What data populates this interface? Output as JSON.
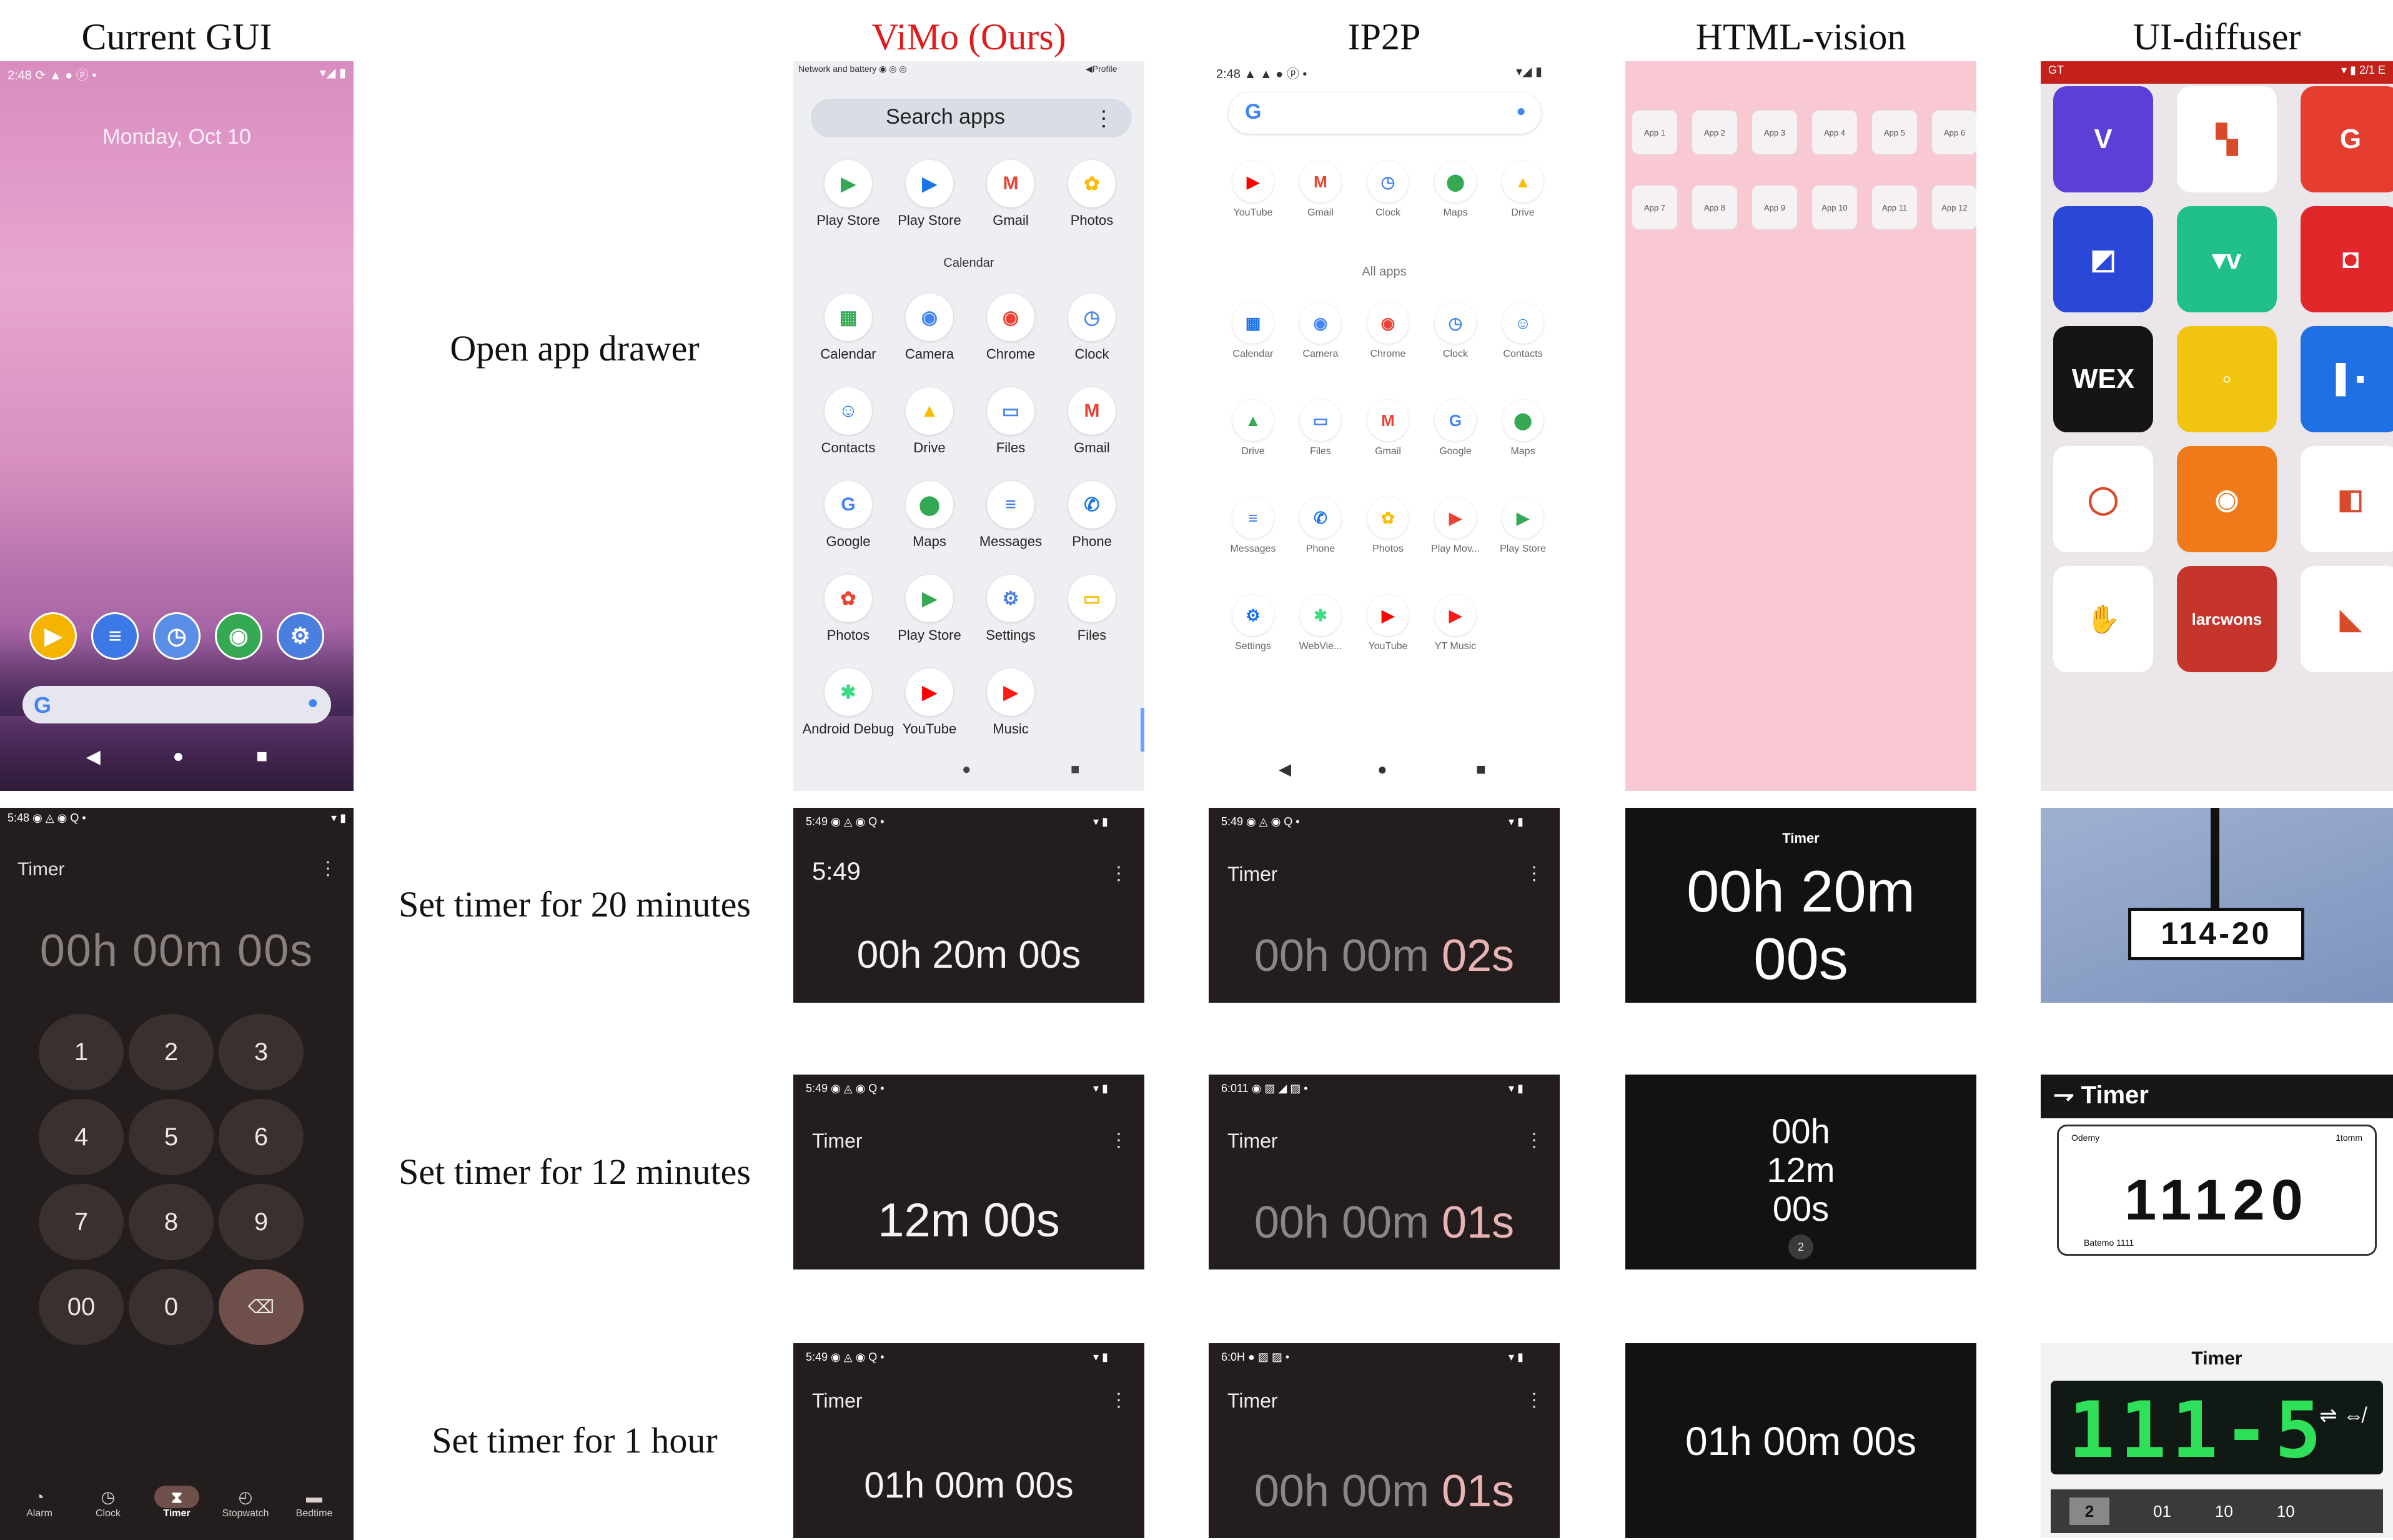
{
  "headers": {
    "current": "Current GUI",
    "vimo": "ViMo (Ours)",
    "ip2p": "IP2P",
    "html_vision": "HTML-vision",
    "ui_diffuser": "UI-diffuser"
  },
  "instructions": [
    "Open app drawer",
    "Set timer for 20 minutes",
    "Set timer for 12 minutes",
    "Set timer for  1 hour"
  ],
  "colors": {
    "vimo_header": "#e01b1b",
    "timer_dark": "#231d1d",
    "hv_pink": "#f8c8d3",
    "key_highlight": "#6e4f49"
  },
  "current_home": {
    "status_time": "2:48",
    "status_icons": "⟳ ▲ ● ⓟ •",
    "status_right": "▾◢ ▮",
    "date": "Monday, Oct 10",
    "dock": [
      {
        "icon": "play-store-icon",
        "glyph": "▶",
        "color": "#f4b400"
      },
      {
        "icon": "messages-icon",
        "glyph": "≡",
        "color": "#3c78e6"
      },
      {
        "icon": "clock-icon",
        "glyph": "◷",
        "color": "#5b8ee6"
      },
      {
        "icon": "chrome-icon",
        "glyph": "◉",
        "color": "#34a853"
      },
      {
        "icon": "settings-icon",
        "glyph": "⚙",
        "color": "#4a7fe0"
      }
    ],
    "nav": [
      "◀",
      "●",
      "■"
    ]
  },
  "current_timer": {
    "status_time": "5:48",
    "status_icons": "◉ ◬ ◉ Q •",
    "status_right": "▾ ▮",
    "title": "Timer",
    "menu": "⋮",
    "display": "00h 00m 00s",
    "keys": [
      "1",
      "2",
      "3",
      "4",
      "5",
      "6",
      "7",
      "8",
      "9",
      "00",
      "0",
      "⌫"
    ],
    "nav": [
      {
        "icon": "◔",
        "label": "Alarm"
      },
      {
        "icon": "◷",
        "label": "Clock"
      },
      {
        "icon": "⧗",
        "label": "Timer",
        "selected": true
      },
      {
        "icon": "◴",
        "label": "Stopwatch"
      },
      {
        "icon": "▬",
        "label": "Bedtime"
      }
    ]
  },
  "vimo_drawer": {
    "status_left": "Network and battery  ◉ ◎ ◎",
    "status_right": "◀Profile",
    "search": "Search apps",
    "menu": "⋮",
    "row0": [
      {
        "label": "Play Store",
        "glyph": "▶",
        "color": "#34a853"
      },
      {
        "label": "Play Store",
        "glyph": "▶",
        "color": "#1a73e8"
      },
      {
        "label": "Gmail",
        "glyph": "M",
        "color": "#ea4335"
      },
      {
        "label": "Photos",
        "glyph": "✿",
        "color": "#fbbc05"
      }
    ],
    "section": "Calendar",
    "apps": [
      {
        "label": "Calendar",
        "glyph": "▦",
        "color": "#34a853"
      },
      {
        "label": "Camera",
        "glyph": "◉",
        "color": "#4285f4"
      },
      {
        "label": "Chrome",
        "glyph": "◉",
        "color": "#ea4335"
      },
      {
        "label": "Clock",
        "glyph": "◷",
        "color": "#4a88e8"
      },
      {
        "label": "Contacts",
        "glyph": "☺",
        "color": "#1a73e8"
      },
      {
        "label": "Drive",
        "glyph": "▲",
        "color": "#fbbc05"
      },
      {
        "label": "Files",
        "glyph": "▭",
        "color": "#4285f4"
      },
      {
        "label": "Gmail",
        "glyph": "M",
        "color": "#ea4335"
      },
      {
        "label": "Google",
        "glyph": "G",
        "color": "#4285f4"
      },
      {
        "label": "Maps",
        "glyph": "⬤",
        "color": "#34a853"
      },
      {
        "label": "Messages",
        "glyph": "≡",
        "color": "#3c78e6"
      },
      {
        "label": "Phone",
        "glyph": "✆",
        "color": "#1a73e8"
      },
      {
        "label": "Photos",
        "glyph": "✿",
        "color": "#ea4335"
      },
      {
        "label": "Play Store",
        "glyph": "▶",
        "color": "#34a853"
      },
      {
        "label": "Settings",
        "glyph": "⚙",
        "color": "#4a7fe0"
      },
      {
        "label": "Files",
        "glyph": "▭",
        "color": "#fbbc05"
      },
      {
        "label": "Android Debug",
        "glyph": "✱",
        "color": "#3ddc84"
      },
      {
        "label": "YouTube",
        "glyph": "▶",
        "color": "#ff0000"
      },
      {
        "label": "Music",
        "glyph": "▶",
        "color": "#ff1a1a"
      },
      {
        "label": "",
        "glyph": "",
        "color": "#eeeff3"
      }
    ],
    "nav": [
      "●",
      "■"
    ]
  },
  "ip2p_drawer": {
    "status_left": "2:48  ▲ ▲ ● ⓟ •",
    "status_right": "▾◢ ▮",
    "row0": [
      {
        "label": "YouTube",
        "glyph": "▶",
        "color": "#ff0000"
      },
      {
        "label": "Gmail",
        "glyph": "M",
        "color": "#ea4335"
      },
      {
        "label": "Clock",
        "glyph": "◷",
        "color": "#4a88e8"
      },
      {
        "label": "Maps",
        "glyph": "⬤",
        "color": "#34a853"
      },
      {
        "label": "Drive",
        "glyph": "▲",
        "color": "#fbbc05"
      }
    ],
    "section": "All apps",
    "apps": [
      {
        "label": "Calendar",
        "glyph": "▦",
        "color": "#1a73e8"
      },
      {
        "label": "Camera",
        "glyph": "◉",
        "color": "#4285f4"
      },
      {
        "label": "Chrome",
        "glyph": "◉",
        "color": "#ea4335"
      },
      {
        "label": "Clock",
        "glyph": "◷",
        "color": "#4a88e8"
      },
      {
        "label": "Contacts",
        "glyph": "☺",
        "color": "#1a73e8"
      },
      {
        "label": "Drive",
        "glyph": "▲",
        "color": "#34a853"
      },
      {
        "label": "Files",
        "glyph": "▭",
        "color": "#4285f4"
      },
      {
        "label": "Gmail",
        "glyph": "M",
        "color": "#ea4335"
      },
      {
        "label": "Google",
        "glyph": "G",
        "color": "#4285f4"
      },
      {
        "label": "Maps",
        "glyph": "⬤",
        "color": "#34a853"
      },
      {
        "label": "Messages",
        "glyph": "≡",
        "color": "#3c78e6"
      },
      {
        "label": "Phone",
        "glyph": "✆",
        "color": "#1a73e8"
      },
      {
        "label": "Photos",
        "glyph": "✿",
        "color": "#fbbc05"
      },
      {
        "label": "Play Mov...",
        "glyph": "▶",
        "color": "#ea4335"
      },
      {
        "label": "Play Store",
        "glyph": "▶",
        "color": "#34a853"
      },
      {
        "label": "Settings",
        "glyph": "⚙",
        "color": "#1a73e8"
      },
      {
        "label": "WebVie...",
        "glyph": "✱",
        "color": "#3ddc84"
      },
      {
        "label": "YouTube",
        "glyph": "▶",
        "color": "#ff0000"
      },
      {
        "label": "YT Music",
        "glyph": "▶",
        "color": "#ff1a1a"
      }
    ],
    "nav": [
      "◀",
      "●",
      "■"
    ]
  },
  "hv_drawer": {
    "apps": [
      "App 1",
      "App 2",
      "App 3",
      "App 4",
      "App 5",
      "App 6",
      "App 7",
      "App 8",
      "App 9",
      "App 10",
      "App 11",
      "App 12"
    ]
  },
  "ud_drawer": {
    "status_left": "GT",
    "status_right": "▾ ▮ 2/1 E",
    "tiles": [
      {
        "glyph": "V",
        "color": "#5b3fd6"
      },
      {
        "glyph": "▚",
        "color": "#ffffff"
      },
      {
        "glyph": "G",
        "color": "#e53d2f"
      },
      {
        "glyph": "◩",
        "color": "#2b47d8"
      },
      {
        "glyph": "▾v",
        "color": "#21c08b"
      },
      {
        "glyph": "◘",
        "color": "#e2272b"
      },
      {
        "glyph": "WEX",
        "color": "#151515"
      },
      {
        "glyph": "◦",
        "color": "#f1c40f"
      },
      {
        "glyph": "▌▪",
        "color": "#1f6fe5"
      },
      {
        "glyph": "◯",
        "color": "#ffffff"
      },
      {
        "glyph": "◉",
        "color": "#f07a1a"
      },
      {
        "glyph": "◧",
        "color": "#ffffff"
      },
      {
        "glyph": "✋",
        "color": "#ffffff"
      },
      {
        "glyph": "larcwons",
        "color": "#c6352b"
      },
      {
        "glyph": "◣",
        "color": "#ffffff"
      }
    ]
  },
  "results": {
    "vimo": [
      {
        "status": "5:49  ◉ ◬ ◉ Q •",
        "status_right": "▾ ▮",
        "title": "5:49",
        "value": "00h 20m 00s",
        "menu": "⋮"
      },
      {
        "status": "5:49  ◉ ◬ ◉ Q •",
        "status_right": "▾ ▮",
        "title": "Timer",
        "value": "12m 00s",
        "menu": "⋮"
      },
      {
        "status": "5:49  ◉ ◬ ◉ Q •",
        "status_right": "▾ ▮",
        "title": "Timer",
        "value": "01h 00m 00s",
        "menu": "⋮"
      }
    ],
    "ip2p": [
      {
        "status": "5:49  ◉ ◬ ◉ Q •",
        "status_right": "▾ ▮",
        "title": "Timer",
        "value_main": "00h 00m ",
        "value_accent": "02s",
        "menu": "⋮"
      },
      {
        "status": "6:011  ◉ ▨ ◢ ▨ •",
        "status_right": "▾ ▮",
        "title": "Timer",
        "value_main": "00h 00m ",
        "value_accent": "01s",
        "menu": "⋮"
      },
      {
        "status": "6:0H  ● ▨ ▨ •",
        "status_right": "▾ ▮",
        "title": "Timer",
        "value_main": "00h 00m ",
        "value_accent": "01s",
        "menu": "⋮"
      }
    ],
    "hv": [
      {
        "small": "Timer",
        "big1": "00h 20m",
        "big2": "00s"
      },
      {
        "l1": "00h",
        "l2": "12m",
        "l3": "00s",
        "dot": "2"
      },
      {
        "value": "01h 00m 00s"
      }
    ],
    "ud": [
      {
        "text": "114-20"
      },
      {
        "title": "Timer",
        "small_l": "Odemy",
        "small_r": "1tomm",
        "number": "11120",
        "sub": "Batemo 1111"
      },
      {
        "title": "Timer",
        "number": "111-5",
        "side": "⇌ ⇎",
        "b1": "2",
        "b2": "01",
        "b3": "10",
        "b4": "10"
      }
    ]
  }
}
